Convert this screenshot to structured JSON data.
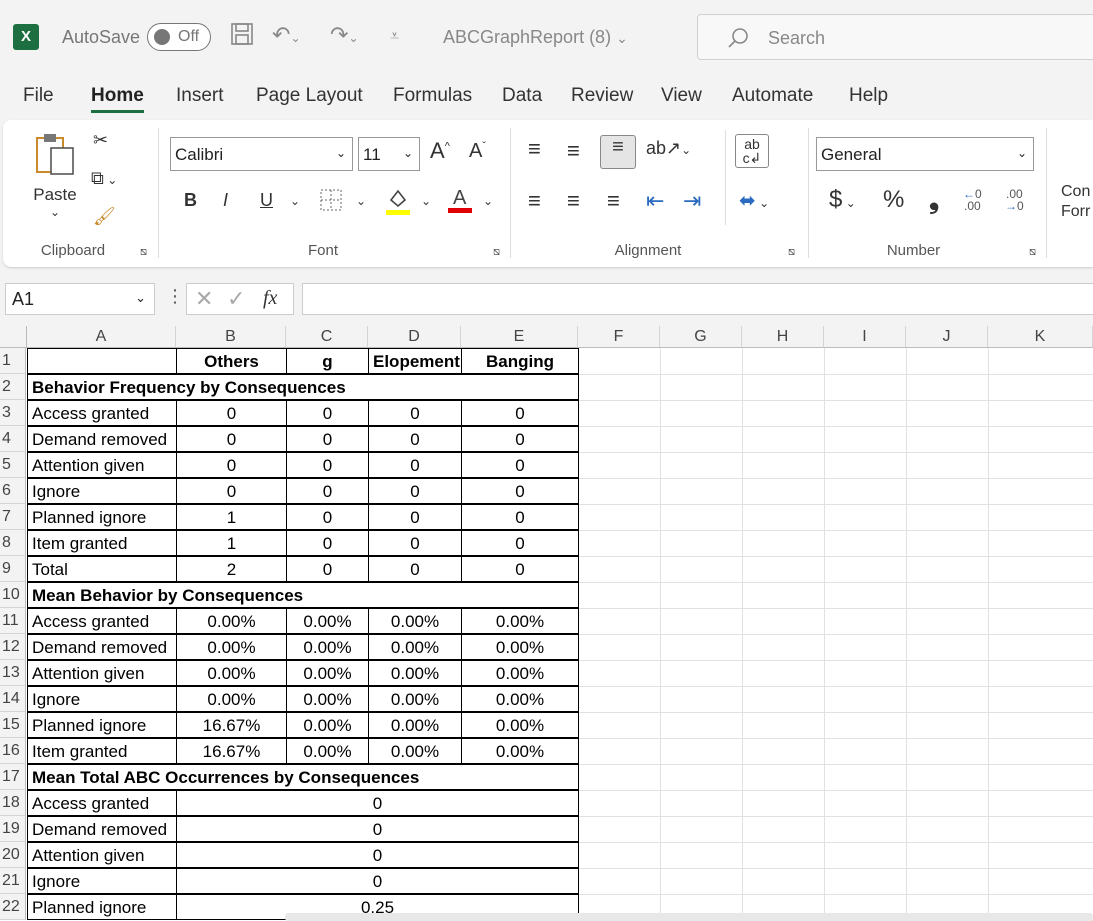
{
  "titlebar": {
    "autosave_label": "AutoSave",
    "toggle_state": "Off",
    "doc_title": "ABCGraphReport (8)",
    "search_placeholder": "Search"
  },
  "menu": {
    "tabs": [
      "File",
      "Home",
      "Insert",
      "Page Layout",
      "Formulas",
      "Data",
      "Review",
      "View",
      "Automate",
      "Help"
    ],
    "active": "Home"
  },
  "ribbon": {
    "clipboard_label": "Clipboard",
    "paste_label": "Paste",
    "font_label": "Font",
    "font_name": "Calibri",
    "font_size": "11",
    "bold": "B",
    "italic": "I",
    "underline": "U",
    "alignment_label": "Alignment",
    "number_label": "Number",
    "number_format": "General",
    "currency": "$",
    "percent": "%",
    "comma": "❟",
    "conditional_partial_1": "Con",
    "conditional_partial_2": "Forr"
  },
  "formula_bar": {
    "name_box": "A1",
    "fx": "fx",
    "content": ""
  },
  "columns": [
    "A",
    "B",
    "C",
    "D",
    "E",
    "F",
    "G",
    "H",
    "I",
    "J",
    "K"
  ],
  "rows": [
    {
      "n": "1",
      "a": "",
      "b": "Others",
      "c": "g",
      "d": "Elopement",
      "e": "Banging",
      "hdr": true
    },
    {
      "n": "2",
      "a": "Behavior Frequency by Consequences",
      "section": true
    },
    {
      "n": "3",
      "a": "Access granted",
      "b": "0",
      "c": "0",
      "d": "0",
      "e": "0"
    },
    {
      "n": "4",
      "a": "Demand removed",
      "b": "0",
      "c": "0",
      "d": "0",
      "e": "0"
    },
    {
      "n": "5",
      "a": "Attention given",
      "b": "0",
      "c": "0",
      "d": "0",
      "e": "0"
    },
    {
      "n": "6",
      "a": "Ignore",
      "b": "0",
      "c": "0",
      "d": "0",
      "e": "0"
    },
    {
      "n": "7",
      "a": "Planned ignore",
      "b": "1",
      "c": "0",
      "d": "0",
      "e": "0"
    },
    {
      "n": "8",
      "a": "Item granted",
      "b": "1",
      "c": "0",
      "d": "0",
      "e": "0"
    },
    {
      "n": "9",
      "a": "Total",
      "b": "2",
      "c": "0",
      "d": "0",
      "e": "0"
    },
    {
      "n": "10",
      "a": "Mean Behavior by Consequences",
      "section": true
    },
    {
      "n": "11",
      "a": "Access granted",
      "b": "0.00%",
      "c": "0.00%",
      "d": "0.00%",
      "e": "0.00%"
    },
    {
      "n": "12",
      "a": "Demand removed",
      "b": "0.00%",
      "c": "0.00%",
      "d": "0.00%",
      "e": "0.00%"
    },
    {
      "n": "13",
      "a": "Attention given",
      "b": "0.00%",
      "c": "0.00%",
      "d": "0.00%",
      "e": "0.00%"
    },
    {
      "n": "14",
      "a": "Ignore",
      "b": "0.00%",
      "c": "0.00%",
      "d": "0.00%",
      "e": "0.00%"
    },
    {
      "n": "15",
      "a": "Planned ignore",
      "b": "16.67%",
      "c": "0.00%",
      "d": "0.00%",
      "e": "0.00%"
    },
    {
      "n": "16",
      "a": "Item granted",
      "b": "16.67%",
      "c": "0.00%",
      "d": "0.00%",
      "e": "0.00%"
    },
    {
      "n": "17",
      "a": "Mean Total ABC Occurrences by Consequences",
      "section": true
    },
    {
      "n": "18",
      "a": "Access granted",
      "merged": "0"
    },
    {
      "n": "19",
      "a": "Demand removed",
      "merged": "0"
    },
    {
      "n": "20",
      "a": "Attention given",
      "merged": "0"
    },
    {
      "n": "21",
      "a": "Ignore",
      "merged": "0"
    },
    {
      "n": "22",
      "a": "Planned ignore",
      "merged": "0.25"
    }
  ],
  "colors": {
    "excel_green": "#1d6f42",
    "highlight_yellow": "#ffff00",
    "font_red": "#e00000"
  }
}
